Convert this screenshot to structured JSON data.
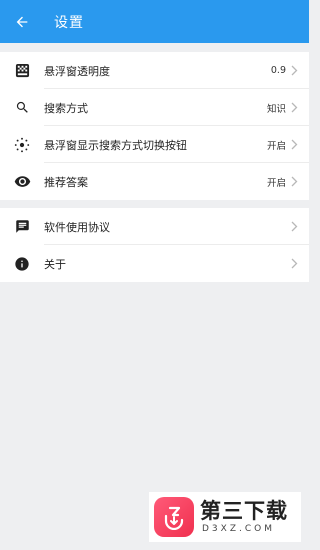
{
  "appbar": {
    "title": "设置",
    "back_icon": "arrow-left-icon",
    "background": "#2a99ee"
  },
  "settings_group_1": [
    {
      "label": "悬浮窗透明度",
      "value": "0.9",
      "icon": "opacity-grid-icon"
    },
    {
      "label": "搜索方式",
      "value": "知识",
      "icon": "search-icon"
    },
    {
      "label": "悬浮窗显示搜索方式切换按钮",
      "value": "开启",
      "icon": "dotted-circle-icon"
    },
    {
      "label": "推荐答案",
      "value": "开启",
      "icon": "eye-icon"
    }
  ],
  "settings_group_2": [
    {
      "label": "软件使用协议",
      "icon": "message-icon"
    },
    {
      "label": "关于",
      "icon": "info-icon"
    }
  ],
  "watermark": {
    "main": "第三下载",
    "sub": "D3XZ.COM"
  }
}
